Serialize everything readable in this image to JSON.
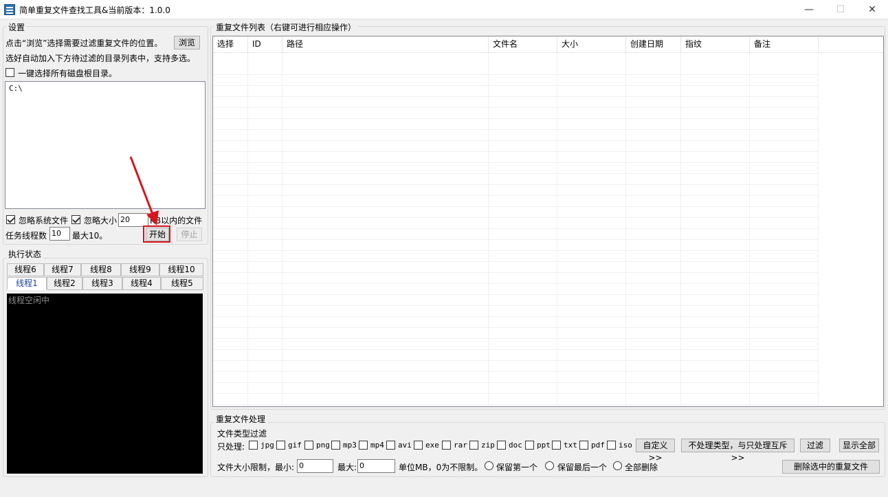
{
  "window": {
    "title": "简单重复文件查找工具&当前版本：1.0.0",
    "min_symbol": "—",
    "max_symbol": "☐",
    "close_symbol": "✕"
  },
  "settings": {
    "group_title": "设置",
    "browse_hint": "点击“浏览”选择需要过滤重复文件的位置。",
    "browse_button": "浏览",
    "auto_add_hint": "选好自动加入下方待过滤的目录列表中，支持多选。",
    "select_all_drives": "一键选择所有磁盘根目录。",
    "paths": [
      "C:\\"
    ],
    "ignore_system_files": "忽略系统文件",
    "ignore_size": "忽略大小",
    "ignore_size_value": "20",
    "ignore_size_unit": "KB以内的文件",
    "threads_label": "任务线程数",
    "threads_value": "10",
    "threads_max": "最大10。",
    "start_button": "开始",
    "stop_button": "停止"
  },
  "status": {
    "group_title": "执行状态",
    "tabs_row1": [
      "线程6",
      "线程7",
      "线程8",
      "线程9",
      "线程10"
    ],
    "tabs_row2": [
      "线程1",
      "线程2",
      "线程3",
      "线程4",
      "线程5"
    ],
    "console_text": "线程空闲中"
  },
  "results": {
    "group_title": "重复文件列表（右键可进行相应操作）",
    "columns": [
      "选择",
      "ID",
      "路径",
      "文件名",
      "大小",
      "创建日期",
      "指纹",
      "备注"
    ]
  },
  "handling": {
    "group_title": "重复文件处理",
    "filter_title": "文件类型过滤",
    "only_process": "只处理:",
    "types": [
      "jpg",
      "gif",
      "png",
      "mp3",
      "mp4",
      "avi",
      "exe",
      "rar",
      "zip",
      "doc",
      "ppt",
      "txt",
      "pdf",
      "iso"
    ],
    "custom_button": "自定义>>",
    "exclude_button": "不处理类型，与只处理互斥>>",
    "filter_button": "过滤",
    "show_all_button": "显示全部",
    "size_limit_label": "文件大小限制，最小:",
    "min_value": "0",
    "max_label": "最大:",
    "max_value": "0",
    "unit_hint": "单位MB，0为不限制。",
    "keep_first": "保留第一个",
    "keep_last": "保留最后一个",
    "delete_all": "全部删除",
    "delete_selected_button": "删除选中的重复文件"
  },
  "colors": {
    "highlight": "#d8141e",
    "active_tab": "#1a44a0"
  }
}
